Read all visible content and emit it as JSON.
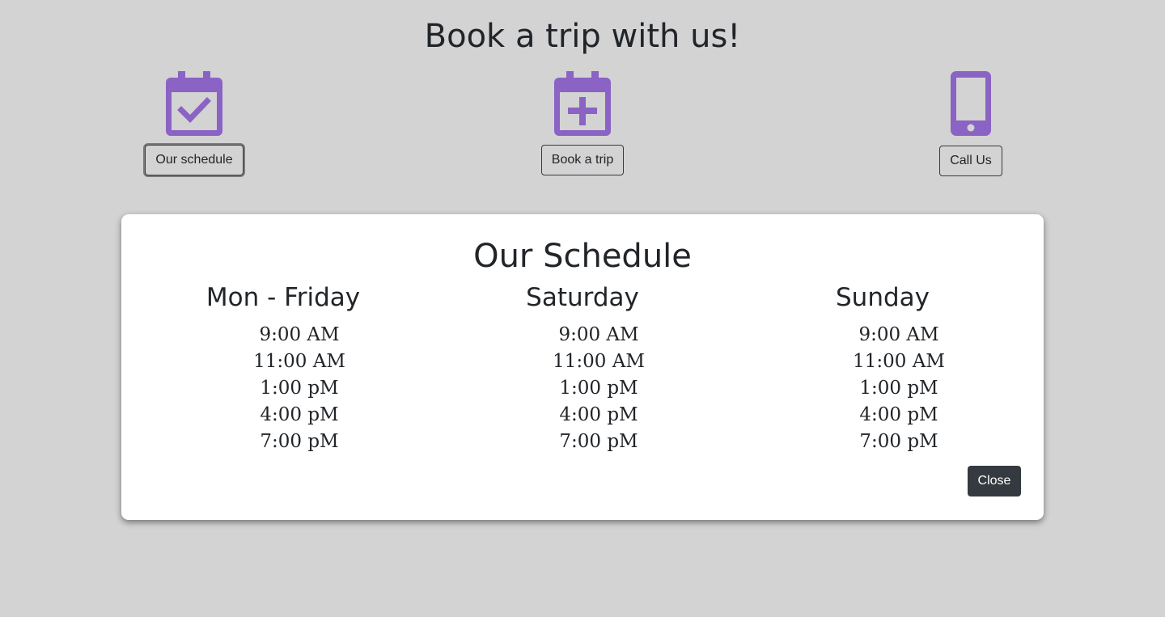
{
  "header": {
    "title": "Book a trip with us!"
  },
  "actions": {
    "schedule": {
      "label": "Our schedule",
      "icon": "calendar-check-icon"
    },
    "book": {
      "label": "Book a trip",
      "icon": "calendar-plus-icon"
    },
    "call": {
      "label": "Call Us",
      "icon": "mobile-phone-icon"
    }
  },
  "modal": {
    "title": "Our Schedule",
    "days": [
      {
        "name": "Mon - Friday",
        "times": [
          "9:00 AM",
          "11:00 AM",
          "1:00 pM",
          "4:00 pM",
          "7:00 pM"
        ]
      },
      {
        "name": "Saturday",
        "times": [
          "9:00 AM",
          "11:00 AM",
          "1:00 pM",
          "4:00 pM",
          "7:00 pM"
        ]
      },
      {
        "name": "Sunday",
        "times": [
          "9:00 AM",
          "11:00 AM",
          "1:00 pM",
          "4:00 pM",
          "7:00 pM"
        ]
      }
    ],
    "close_label": "Close"
  },
  "colors": {
    "background": "#d3d3d3",
    "icon_accent": "#8a63c4",
    "close_button": "#343a40",
    "text": "#212529"
  }
}
